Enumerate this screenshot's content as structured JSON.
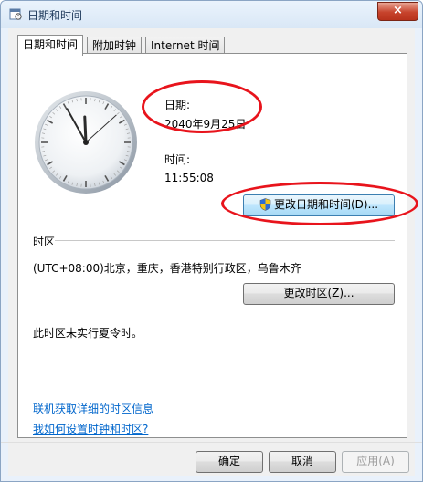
{
  "window": {
    "title": "日期和时间",
    "close_label": "×"
  },
  "tabs": [
    {
      "label": "日期和时间"
    },
    {
      "label": "附加时钟"
    },
    {
      "label": "Internet 时间"
    }
  ],
  "date_section": {
    "label": "日期:",
    "value": "2040年9月25日"
  },
  "time_section": {
    "label": "时间:",
    "value": "11:55:08"
  },
  "change_datetime_button": "更改日期和时间(D)...",
  "timezone": {
    "heading": "时区",
    "value": "(UTC+08:00)北京，重庆，香港特别行政区，乌鲁木齐",
    "change_button": "更改时区(Z)..."
  },
  "dst_note": "此时区未实行夏令时。",
  "links": {
    "online_info": "联机获取详细的时区信息",
    "how_to_set": "我如何设置时钟和时区?"
  },
  "footer": {
    "ok": "确定",
    "cancel": "取消",
    "apply": "应用(A)"
  },
  "annotation_color": "#e8141c",
  "clock": {
    "hours": 11,
    "minutes": 55,
    "seconds": 8
  }
}
